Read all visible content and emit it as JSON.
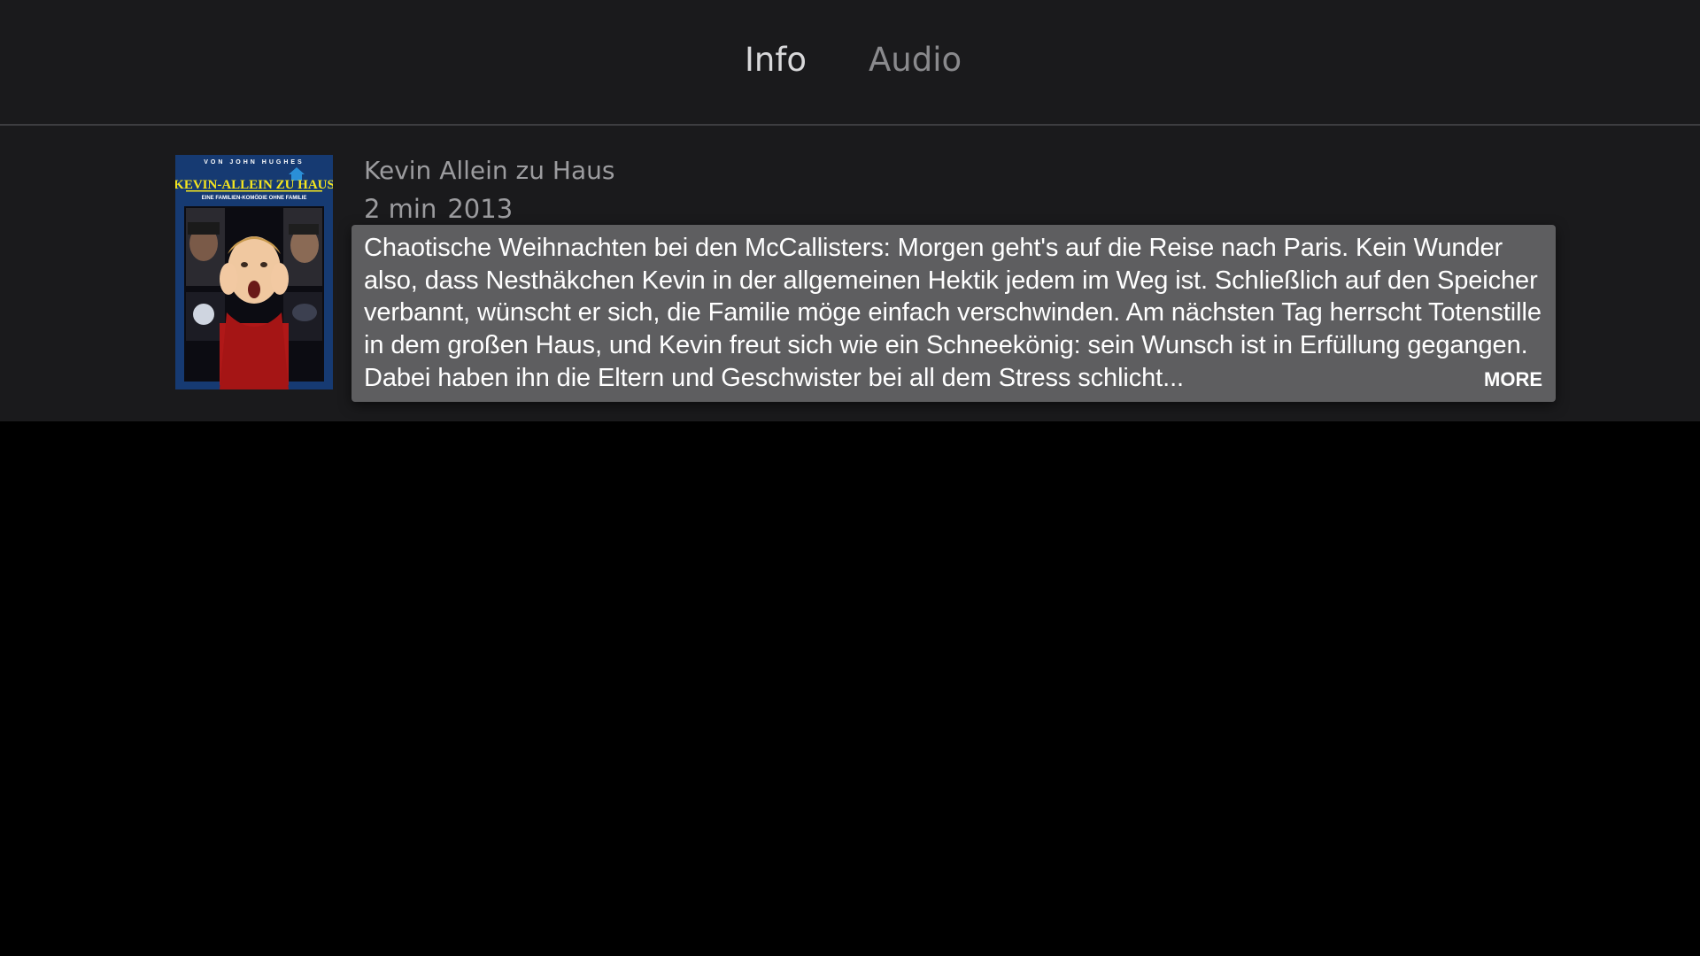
{
  "tabs": [
    {
      "label": "Info",
      "active": true
    },
    {
      "label": "Audio",
      "active": false
    }
  ],
  "movie": {
    "title": "Kevin Allein zu Haus",
    "duration": "2 min",
    "year": "2013",
    "description": "Chaotische Weihnachten bei den McCallisters: Morgen geht's auf die Reise nach Paris. Kein Wunder also, dass Nesthäkchen Kevin in der allgemeinen Hektik jedem im Weg ist. Schließlich auf den Speicher verbannt, wünscht er sich, die Familie möge einfach verschwinden. Am nächsten Tag herrscht Totenstille in dem großen Haus, und Kevin freut sich wie ein Schneekönig: sein Wunsch ist in Erfüllung gegangen. Dabei haben ihn die Eltern und Geschwister bei all dem Stress schlicht...",
    "more_label": "MORE",
    "poster": {
      "top_line": "VON JOHN HUGHES",
      "title_line": "KEVIN-ALLEIN ZU HAUS",
      "tagline": "EINE FAMILIEN-KOMÖDIE OHNE FAMILIE"
    }
  },
  "colors": {
    "panel_background": "#1a1a1c",
    "page_background": "#000000",
    "tab_active": "#d8d8da",
    "tab_inactive": "#8a8a8d",
    "description_focus_background": "#5e5e60",
    "poster_accent": "#f5e61e"
  }
}
